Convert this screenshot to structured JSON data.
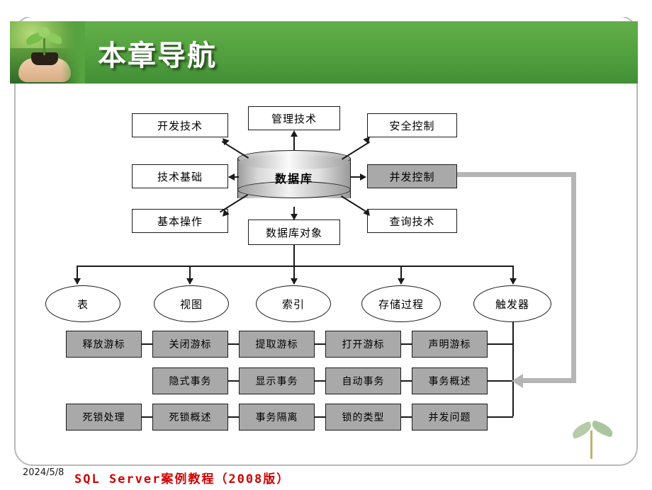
{
  "header": {
    "title": "本章导航",
    "logo_alt": "seedling-in-hand-photo"
  },
  "diagram": {
    "center": {
      "label": "数据库"
    },
    "spokes": [
      {
        "key": "dev",
        "label": "开发技术",
        "highlighted": false
      },
      {
        "key": "basis",
        "label": "技术基础",
        "highlighted": false
      },
      {
        "key": "basicop",
        "label": "基本操作",
        "highlighted": false
      },
      {
        "key": "manage",
        "label": "管理技术",
        "highlighted": false
      },
      {
        "key": "security",
        "label": "安全控制",
        "highlighted": false
      },
      {
        "key": "concur",
        "label": "并发控制",
        "highlighted": true
      },
      {
        "key": "query",
        "label": "查询技术",
        "highlighted": false
      },
      {
        "key": "dbobject",
        "label": "数据库对象",
        "highlighted": false
      }
    ],
    "objects": [
      {
        "label": "表"
      },
      {
        "label": "视图"
      },
      {
        "label": "索引"
      },
      {
        "label": "存储过程"
      },
      {
        "label": "触发器"
      }
    ],
    "rows": [
      {
        "key": "cursor-row",
        "cells": [
          "释放游标",
          "关闭游标",
          "提取游标",
          "打开游标",
          "声明游标"
        ]
      },
      {
        "key": "transaction-row",
        "cells": [
          "隐式事务",
          "显示事务",
          "自动事务",
          "事务概述"
        ]
      },
      {
        "key": "lock-row",
        "cells": [
          "死锁处理",
          "死锁概述",
          "事务隔离",
          "锁的类型",
          "并发问题"
        ]
      }
    ]
  },
  "footer": {
    "date": "2024/5/8",
    "title": "SQL Server案例教程（2008版）"
  },
  "colors": {
    "header_green_top": "#63ae4b",
    "header_green_bottom": "#429036",
    "highlight_gray": "#a9a9a9",
    "connector_gray": "#b5b5b5",
    "footer_red": "#d00000",
    "frame_border": "#b9b9b9"
  }
}
